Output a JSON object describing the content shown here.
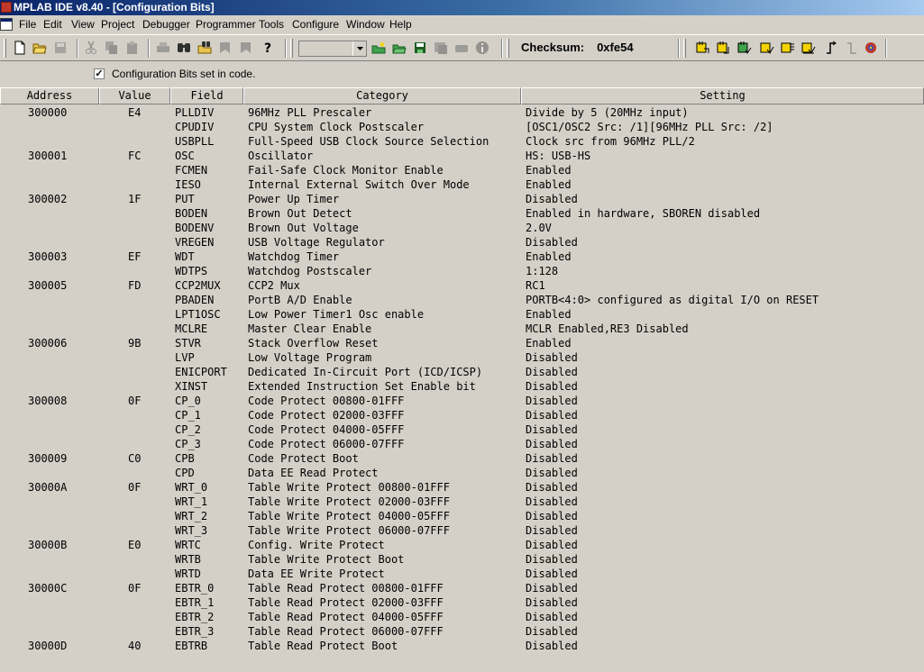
{
  "window": {
    "title": "MPLAB IDE v8.40 - [Configuration Bits]"
  },
  "menu": [
    "File",
    "Edit",
    "View",
    "Project",
    "Debugger",
    "Programmer",
    "Tools",
    "Configure",
    "Window",
    "Help"
  ],
  "toolbar": {
    "checksum_label": "Checksum:",
    "checksum_value": "0xfe54",
    "combo_value": ""
  },
  "option": {
    "checkbox_checked": true,
    "checkbox_label": "Configuration Bits set in code."
  },
  "columns": [
    "Address",
    "Value",
    "Field",
    "Category",
    "Setting"
  ],
  "rows": [
    {
      "address": "300000",
      "value": "E4",
      "field": "PLLDIV",
      "category": "96MHz PLL Prescaler",
      "setting": "Divide by 5 (20MHz input)"
    },
    {
      "address": "",
      "value": "",
      "field": "CPUDIV",
      "category": "CPU System Clock Postscaler",
      "setting": "[OSC1/OSC2 Src: /1][96MHz PLL Src: /2]"
    },
    {
      "address": "",
      "value": "",
      "field": "USBPLL",
      "category": "Full-Speed USB Clock Source Selection",
      "setting": "Clock src from 96MHz PLL/2"
    },
    {
      "address": "300001",
      "value": "FC",
      "field": "OSC",
      "category": "Oscillator",
      "setting": "HS: USB-HS"
    },
    {
      "address": "",
      "value": "",
      "field": "FCMEN",
      "category": "Fail-Safe Clock Monitor Enable",
      "setting": "Enabled"
    },
    {
      "address": "",
      "value": "",
      "field": "IESO",
      "category": "Internal External Switch Over Mode",
      "setting": "Enabled"
    },
    {
      "address": "300002",
      "value": "1F",
      "field": "PUT",
      "category": "Power Up Timer",
      "setting": "Disabled"
    },
    {
      "address": "",
      "value": "",
      "field": "BODEN",
      "category": "Brown Out Detect",
      "setting": "Enabled in hardware, SBOREN disabled"
    },
    {
      "address": "",
      "value": "",
      "field": "BODENV",
      "category": "Brown Out Voltage",
      "setting": "2.0V"
    },
    {
      "address": "",
      "value": "",
      "field": "VREGEN",
      "category": "USB Voltage Regulator",
      "setting": "Disabled"
    },
    {
      "address": "300003",
      "value": "EF",
      "field": "WDT",
      "category": "Watchdog Timer",
      "setting": "Enabled"
    },
    {
      "address": "",
      "value": "",
      "field": "WDTPS",
      "category": "Watchdog Postscaler",
      "setting": "1:128"
    },
    {
      "address": "300005",
      "value": "FD",
      "field": "CCP2MUX",
      "category": "CCP2 Mux",
      "setting": "RC1"
    },
    {
      "address": "",
      "value": "",
      "field": "PBADEN",
      "category": "PortB A/D Enable",
      "setting": "PORTB<4:0> configured as digital I/O on RESET"
    },
    {
      "address": "",
      "value": "",
      "field": "LPT1OSC",
      "category": "Low Power Timer1 Osc enable",
      "setting": "Enabled"
    },
    {
      "address": "",
      "value": "",
      "field": "MCLRE",
      "category": "Master Clear Enable",
      "setting": "MCLR Enabled,RE3 Disabled"
    },
    {
      "address": "300006",
      "value": "9B",
      "field": "STVR",
      "category": "Stack Overflow Reset",
      "setting": "Enabled"
    },
    {
      "address": "",
      "value": "",
      "field": "LVP",
      "category": "Low Voltage Program",
      "setting": "Disabled"
    },
    {
      "address": "",
      "value": "",
      "field": "ENICPORT",
      "category": "Dedicated In-Circuit Port (ICD/ICSP)",
      "setting": "Disabled"
    },
    {
      "address": "",
      "value": "",
      "field": "XINST",
      "category": "Extended Instruction Set Enable bit",
      "setting": "Disabled"
    },
    {
      "address": "300008",
      "value": "0F",
      "field": "CP_0",
      "category": "Code Protect 00800-01FFF",
      "setting": "Disabled"
    },
    {
      "address": "",
      "value": "",
      "field": "CP_1",
      "category": "Code Protect 02000-03FFF",
      "setting": "Disabled"
    },
    {
      "address": "",
      "value": "",
      "field": "CP_2",
      "category": "Code Protect 04000-05FFF",
      "setting": "Disabled"
    },
    {
      "address": "",
      "value": "",
      "field": "CP_3",
      "category": "Code Protect 06000-07FFF",
      "setting": "Disabled"
    },
    {
      "address": "300009",
      "value": "C0",
      "field": "CPB",
      "category": "Code Protect Boot",
      "setting": "Disabled"
    },
    {
      "address": "",
      "value": "",
      "field": "CPD",
      "category": "Data EE Read Protect",
      "setting": "Disabled"
    },
    {
      "address": "30000A",
      "value": "0F",
      "field": "WRT_0",
      "category": "Table Write Protect 00800-01FFF",
      "setting": "Disabled"
    },
    {
      "address": "",
      "value": "",
      "field": "WRT_1",
      "category": "Table Write Protect 02000-03FFF",
      "setting": "Disabled"
    },
    {
      "address": "",
      "value": "",
      "field": "WRT_2",
      "category": "Table Write Protect 04000-05FFF",
      "setting": "Disabled"
    },
    {
      "address": "",
      "value": "",
      "field": "WRT_3",
      "category": "Table Write Protect 06000-07FFF",
      "setting": "Disabled"
    },
    {
      "address": "30000B",
      "value": "E0",
      "field": "WRTC",
      "category": "Config. Write Protect",
      "setting": "Disabled"
    },
    {
      "address": "",
      "value": "",
      "field": "WRTB",
      "category": "Table Write Protect Boot",
      "setting": "Disabled"
    },
    {
      "address": "",
      "value": "",
      "field": "WRTD",
      "category": "Data EE Write Protect",
      "setting": "Disabled"
    },
    {
      "address": "30000C",
      "value": "0F",
      "field": "EBTR_0",
      "category": "Table Read Protect 00800-01FFF",
      "setting": "Disabled"
    },
    {
      "address": "",
      "value": "",
      "field": "EBTR_1",
      "category": "Table Read Protect 02000-03FFF",
      "setting": "Disabled"
    },
    {
      "address": "",
      "value": "",
      "field": "EBTR_2",
      "category": "Table Read Protect 04000-05FFF",
      "setting": "Disabled"
    },
    {
      "address": "",
      "value": "",
      "field": "EBTR_3",
      "category": "Table Read Protect 06000-07FFF",
      "setting": "Disabled"
    },
    {
      "address": "30000D",
      "value": "40",
      "field": "EBTRB",
      "category": "Table Read Protect Boot",
      "setting": "Disabled"
    }
  ],
  "colors": {
    "titlebar_start": "#0a246a",
    "titlebar_end": "#a6caf0",
    "face": "#d4d0c8"
  }
}
